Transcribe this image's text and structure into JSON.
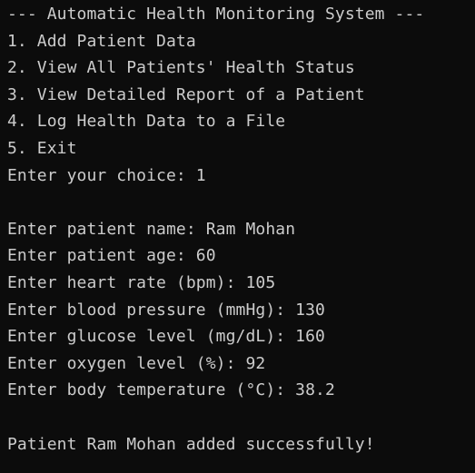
{
  "terminal": {
    "header": "--- Automatic Health Monitoring System ---",
    "menu": [
      "1. Add Patient Data",
      "2. View All Patients' Health Status",
      "3. View Detailed Report of a Patient",
      "4. Log Health Data to a File",
      "5. Exit"
    ],
    "choice_prompt": "Enter your choice: 1",
    "inputs": [
      "Enter patient name: Ram Mohan",
      "Enter patient age: 60",
      "Enter heart rate (bpm): 105",
      "Enter blood pressure (mmHg): 130",
      "Enter glucose level (mg/dL): 160",
      "Enter oxygen level (%): 92",
      "Enter body temperature (°C): 38.2"
    ],
    "success_message": "Patient Ram Mohan added successfully!"
  },
  "colors": {
    "background": "#0c0c0c",
    "text": "#cccccc"
  }
}
